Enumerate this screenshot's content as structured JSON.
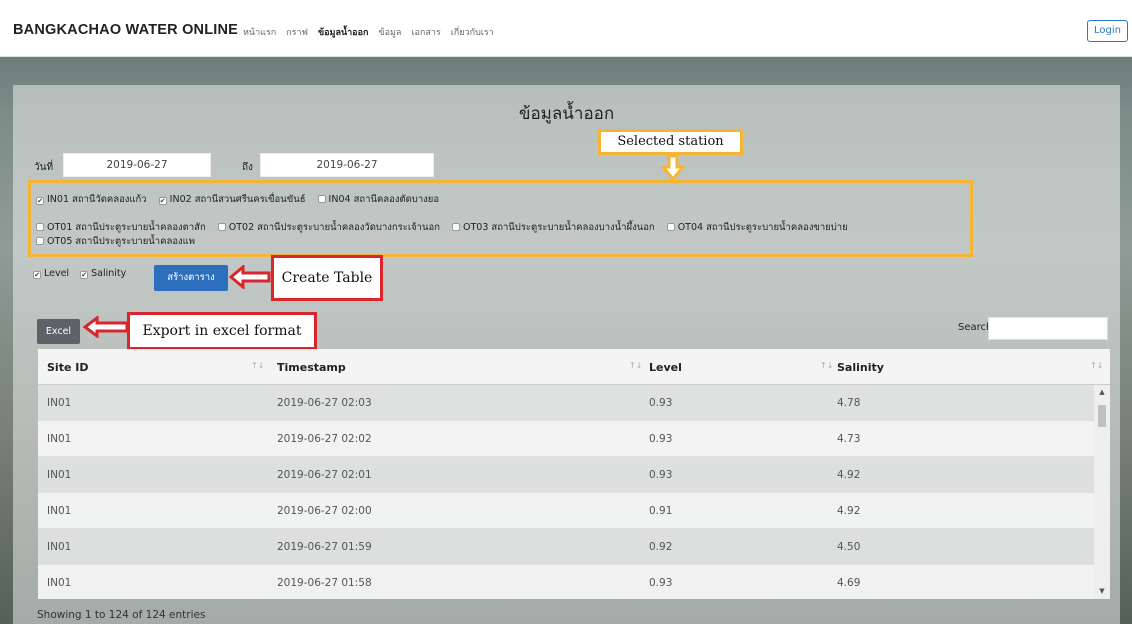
{
  "nav": {
    "brand": "BANGKACHAO WATER ONLINE",
    "links": [
      {
        "label": "หน้าแรก",
        "active": false
      },
      {
        "label": "กราฟ",
        "active": false
      },
      {
        "label": "ข้อมูลน้ำออก",
        "active": true
      },
      {
        "label": "ข้อมูล",
        "active": false
      },
      {
        "label": "เอกสาร",
        "active": false
      },
      {
        "label": "เกี่ยวกับเรา",
        "active": false
      }
    ],
    "login": "Login"
  },
  "page": {
    "title": "ข้อมูลน้ำออก",
    "from_label": "วันที่",
    "from_value": "2019-06-27",
    "to_label": "ถึง",
    "to_value": "2019-06-27"
  },
  "stations": {
    "row1": [
      {
        "label": "IN01 สถานีวัดคลองแก้ว",
        "checked": true
      },
      {
        "label": "IN02 สถานีสวนศรีนครเขื่อนขันธ์",
        "checked": true
      },
      {
        "label": "IN04 สถานีคลองตัดบางยอ",
        "checked": false
      }
    ],
    "row2": [
      {
        "label": "OT01 สถานีประตูระบายน้ำคลองตาสัก",
        "checked": false
      },
      {
        "label": "OT02 สถานีประตูระบายน้ำคลองวัดบางกระเจ้านอก",
        "checked": false
      },
      {
        "label": "OT03 สถานีประตูระบายน้ำคลองบางน้ำผึ้งนอก",
        "checked": false
      },
      {
        "label": "OT04 สถานีประตูระบายน้ำคลองขายบ่าย",
        "checked": false
      }
    ],
    "row3": [
      {
        "label": "OT05 สถานีประตูระบายน้ำคลองแพ",
        "checked": false
      }
    ]
  },
  "options": {
    "level_label": "Level",
    "salinity_label": "Salinity",
    "create_button": "สร้างตาราง",
    "excel_button": "Excel",
    "search_label": "Search:",
    "search_value": ""
  },
  "annotations": {
    "selected_station": "Selected station",
    "create_table": "Create Table",
    "export_excel": "Export in excel format"
  },
  "table": {
    "columns": [
      "Site ID",
      "Timestamp",
      "Level",
      "Salinity"
    ],
    "rows": [
      [
        "IN01",
        "2019-06-27 02:03",
        "0.93",
        "4.78"
      ],
      [
        "IN01",
        "2019-06-27 02:02",
        "0.93",
        "4.73"
      ],
      [
        "IN01",
        "2019-06-27 02:01",
        "0.93",
        "4.92"
      ],
      [
        "IN01",
        "2019-06-27 02:00",
        "0.91",
        "4.92"
      ],
      [
        "IN01",
        "2019-06-27 01:59",
        "0.92",
        "4.50"
      ],
      [
        "IN01",
        "2019-06-27 01:58",
        "0.93",
        "4.69"
      ]
    ],
    "info": "Showing 1 to 124 of 124 entries"
  },
  "colors": {
    "annotation_yellow": "#f4b533",
    "annotation_red": "#d8262c",
    "primary": "#2b6fbd"
  }
}
